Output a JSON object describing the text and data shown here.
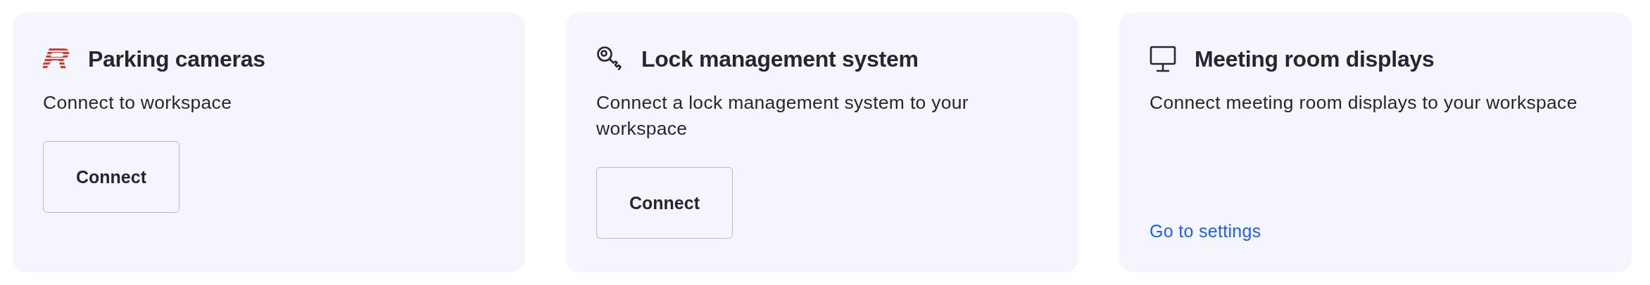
{
  "cards": [
    {
      "kind": "logo",
      "title": "Parking cameras",
      "description": "Connect to workspace",
      "action": {
        "kind": "button",
        "label": "Connect"
      }
    },
    {
      "kind": "key",
      "title": "Lock management system",
      "description": "Connect a lock management system to your workspace",
      "action": {
        "kind": "button",
        "label": "Connect"
      }
    },
    {
      "kind": "monitor",
      "title": "Meeting room displays",
      "description": "Connect meeting room displays to your workspace",
      "action": {
        "kind": "link",
        "label": "Go to settings"
      }
    }
  ]
}
